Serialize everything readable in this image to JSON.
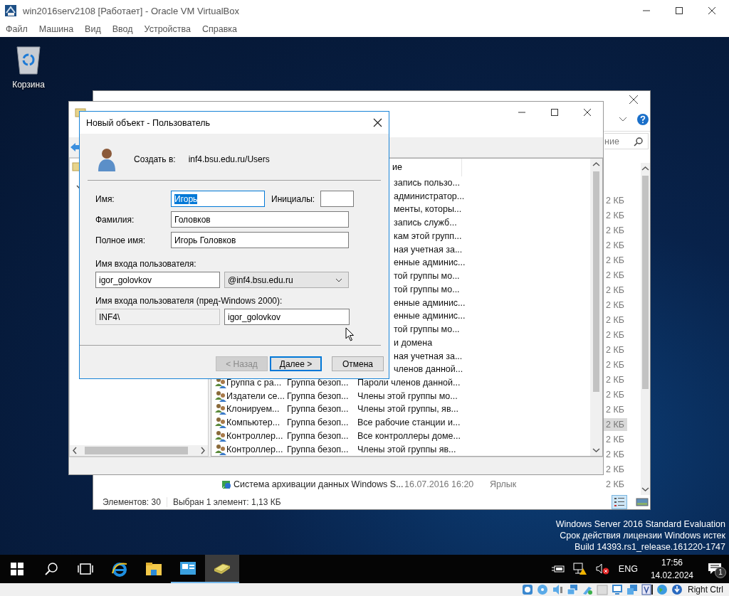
{
  "host_window": {
    "title": "win2016serv2108 [Работает] - Oracle VM VirtualBox",
    "menu": [
      "Файл",
      "Машина",
      "Вид",
      "Ввод",
      "Устройства",
      "Справка"
    ],
    "status_bar": {
      "host_key": "Right Ctrl"
    }
  },
  "desktop": {
    "icons": [
      {
        "label": "Корзина"
      }
    ],
    "evaluation_notice": [
      "Windows Server 2016 Standard Evaluation",
      "Срок действия лицензии Windows истек",
      "Build 14393.rs1_release.161220-1747"
    ]
  },
  "explorer": {
    "search": {
      "placeholder": "ние"
    },
    "rows": [
      {
        "size": "2 КБ",
        "selected": false
      },
      {
        "size": "2 КБ",
        "selected": false
      },
      {
        "size": "2 КБ",
        "selected": false
      },
      {
        "size": "2 КБ",
        "selected": false
      },
      {
        "size": "2 КБ",
        "selected": false
      },
      {
        "size": "2 КБ",
        "selected": false
      },
      {
        "size": "2 КБ",
        "selected": false
      },
      {
        "size": "2 КБ",
        "selected": false
      },
      {
        "size": "2 КБ",
        "selected": false
      },
      {
        "size": "2 КБ",
        "selected": false
      },
      {
        "size": "2 КБ",
        "selected": false
      },
      {
        "size": "2 КБ",
        "selected": false
      },
      {
        "size": "2 КБ",
        "selected": false
      },
      {
        "size": "2 КБ",
        "selected": false
      },
      {
        "size": "2 КБ",
        "selected": false
      },
      {
        "size": "2 КБ",
        "selected": true
      },
      {
        "size": "2 КБ",
        "selected": false
      },
      {
        "size": "2 КБ",
        "selected": false
      },
      {
        "size": "2 КБ",
        "selected": false
      },
      {
        "name": "Система архивации данных Windows S...",
        "date": "16.07.2016 16:20",
        "type": "Ярлык",
        "size": "2 КБ",
        "selected": false
      }
    ],
    "status_bar": {
      "items_count": "Элементов: 30",
      "selection": "Выбран 1 элемент: 1,13 КБ"
    }
  },
  "aduc": {
    "list": {
      "header": "ие",
      "rows": [
        {
          "kind": "partial",
          "text": "запись пользо..."
        },
        {
          "kind": "partial",
          "text": "администратор..."
        },
        {
          "kind": "partial",
          "text": "менты, которы..."
        },
        {
          "kind": "partial",
          "text": "запись служб..."
        },
        {
          "kind": "partial",
          "text": "кам этой групп..."
        },
        {
          "kind": "partial",
          "text": "ная учетная за..."
        },
        {
          "kind": "partial",
          "text": "енные админис..."
        },
        {
          "kind": "partial",
          "text": "той группы мо..."
        },
        {
          "kind": "partial",
          "text": "той группы мо..."
        },
        {
          "kind": "partial",
          "text": "енные админис..."
        },
        {
          "kind": "partial",
          "text": "енные админис..."
        },
        {
          "kind": "partial",
          "text": "той группы мо..."
        },
        {
          "kind": "partial",
          "text": "и домена"
        },
        {
          "kind": "partial",
          "text": "ная учетная за..."
        },
        {
          "kind": "partial",
          "text": "членов данной..."
        },
        {
          "kind": "full",
          "name": "Группа с ра...",
          "type": "Группа безоп...",
          "description": "Пароли членов данной..."
        },
        {
          "kind": "full",
          "name": "Издатели се...",
          "type": "Группа безоп...",
          "description": "Члены этой группы мо..."
        },
        {
          "kind": "full",
          "name": "Клонируем...",
          "type": "Группа безоп...",
          "description": "Члены этой группы, яв..."
        },
        {
          "kind": "full",
          "name": "Компьютер...",
          "type": "Группа безоп...",
          "description": "Все рабочие станции и..."
        },
        {
          "kind": "full",
          "name": "Контроллер...",
          "type": "Группа безоп...",
          "description": "Все контроллеры доме..."
        },
        {
          "kind": "full",
          "name": "Контроллер...",
          "type": "Группа безоп...",
          "description": "Члены этой группы яв..."
        }
      ]
    }
  },
  "dialog": {
    "title": "Новый объект - Пользователь",
    "create_in_label": "Создать в:",
    "create_in_path": "inf4.bsu.edu.ru/Users",
    "first_name": {
      "label": "Имя:",
      "value": "Игорь",
      "selected": true
    },
    "initials": {
      "label": "Инициалы:"
    },
    "last_name": {
      "label": "Фамилия:",
      "value": "Головков"
    },
    "full_name": {
      "label": "Полное имя:",
      "value": "Игорь Головков"
    },
    "logon_name": {
      "label": "Имя входа пользователя:",
      "value": "igor_golovkov",
      "domain": "@inf4.bsu.edu.ru"
    },
    "pre2000_logon": {
      "label": "Имя входа пользователя (пред-Windows 2000):",
      "domain": "INF4\\",
      "domain_disabled": true,
      "value": "igor_golovkov"
    },
    "buttons": [
      {
        "label": "< Назад",
        "disabled": true,
        "default": false
      },
      {
        "label": "Далее >",
        "disabled": false,
        "default": true
      },
      {
        "label": "Отмена",
        "disabled": false,
        "default": false
      }
    ]
  },
  "taskbar": {
    "apps": [
      {
        "kind": "start",
        "running": false,
        "selected": false
      },
      {
        "kind": "search",
        "running": false,
        "selected": false
      },
      {
        "kind": "task-view",
        "running": false,
        "selected": false
      },
      {
        "kind": "browser",
        "running": false,
        "selected": false
      },
      {
        "kind": "explorer",
        "running": false,
        "selected": false
      },
      {
        "kind": "directory",
        "running": true,
        "selected": false
      },
      {
        "kind": "admin-tools",
        "running": true,
        "selected": true
      }
    ],
    "language": "ENG",
    "time": "17:56",
    "date": "14.02.2024",
    "notifications": "1"
  }
}
